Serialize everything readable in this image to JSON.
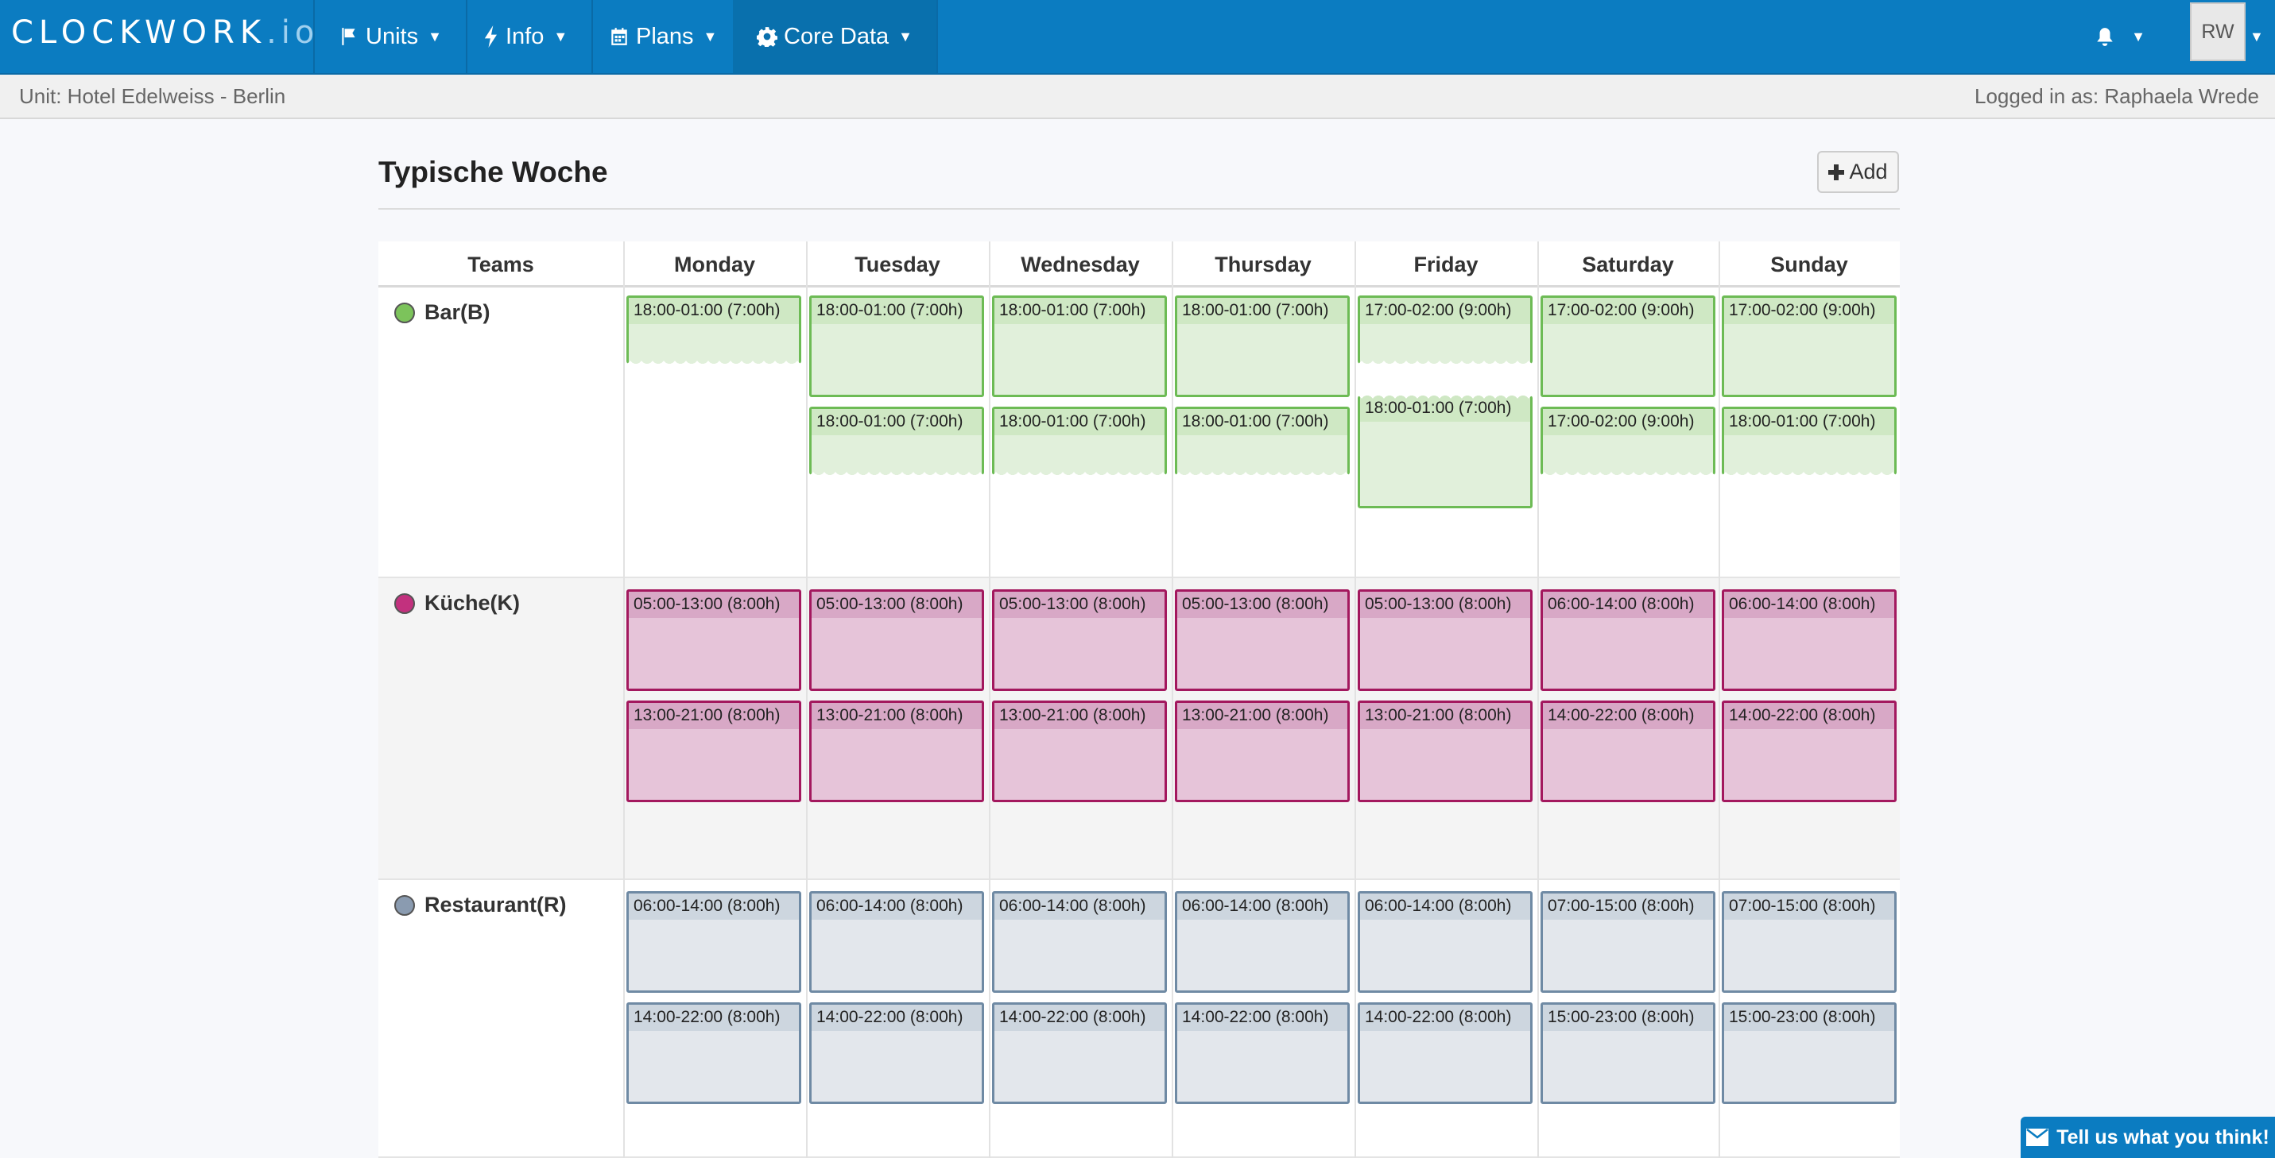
{
  "brand": {
    "name": "CLOCKWORK",
    "suffix": ".io"
  },
  "nav": [
    {
      "label": "Units",
      "icon": "flag-icon"
    },
    {
      "label": "Info",
      "icon": "bolt-icon"
    },
    {
      "label": "Plans",
      "icon": "calendar-icon"
    },
    {
      "label": "Core Data",
      "icon": "gear-icon"
    }
  ],
  "user": {
    "initials": "RW"
  },
  "status": {
    "unit": "Unit: Hotel Edelweiss - Berlin",
    "logged_in": "Logged in as: Raphaela Wrede"
  },
  "page": {
    "title": "Typische Woche",
    "add_label": "Add"
  },
  "table": {
    "teams_header": "Teams",
    "days": [
      "Monday",
      "Tuesday",
      "Wednesday",
      "Thursday",
      "Friday",
      "Saturday",
      "Sunday"
    ],
    "teams": [
      {
        "name": "Bar(B)",
        "color": "#7cc35b",
        "shifts": [
          [
            "18:00-01:00 (7:00h)"
          ],
          [
            "18:00-01:00 (7:00h)",
            "18:00-01:00 (7:00h)"
          ],
          [
            "18:00-01:00 (7:00h)",
            "18:00-01:00 (7:00h)"
          ],
          [
            "18:00-01:00 (7:00h)",
            "18:00-01:00 (7:00h)"
          ],
          [
            "17:00-02:00 (9:00h)",
            "18:00-01:00 (7:00h)"
          ],
          [
            "17:00-02:00 (9:00h)",
            "17:00-02:00 (9:00h)"
          ],
          [
            "17:00-02:00 (9:00h)",
            "18:00-01:00 (7:00h)"
          ]
        ]
      },
      {
        "name": "Küche(K)",
        "color": "#c2317e",
        "shifts": [
          [
            "05:00-13:00 (8:00h)",
            "13:00-21:00 (8:00h)"
          ],
          [
            "05:00-13:00 (8:00h)",
            "13:00-21:00 (8:00h)"
          ],
          [
            "05:00-13:00 (8:00h)",
            "13:00-21:00 (8:00h)"
          ],
          [
            "05:00-13:00 (8:00h)",
            "13:00-21:00 (8:00h)"
          ],
          [
            "05:00-13:00 (8:00h)",
            "13:00-21:00 (8:00h)"
          ],
          [
            "06:00-14:00 (8:00h)",
            "14:00-22:00 (8:00h)"
          ],
          [
            "06:00-14:00 (8:00h)",
            "14:00-22:00 (8:00h)"
          ]
        ]
      },
      {
        "name": "Restaurant(R)",
        "color": "#8a9bb0",
        "shifts": [
          [
            "06:00-14:00 (8:00h)",
            "14:00-22:00 (8:00h)"
          ],
          [
            "06:00-14:00 (8:00h)",
            "14:00-22:00 (8:00h)"
          ],
          [
            "06:00-14:00 (8:00h)",
            "14:00-22:00 (8:00h)"
          ],
          [
            "06:00-14:00 (8:00h)",
            "14:00-22:00 (8:00h)"
          ],
          [
            "06:00-14:00 (8:00h)",
            "14:00-22:00 (8:00h)"
          ],
          [
            "07:00-15:00 (8:00h)",
            "15:00-23:00 (8:00h)"
          ],
          [
            "07:00-15:00 (8:00h)",
            "15:00-23:00 (8:00h)"
          ]
        ]
      }
    ]
  },
  "feedback": {
    "label": "Tell us what you think!"
  }
}
